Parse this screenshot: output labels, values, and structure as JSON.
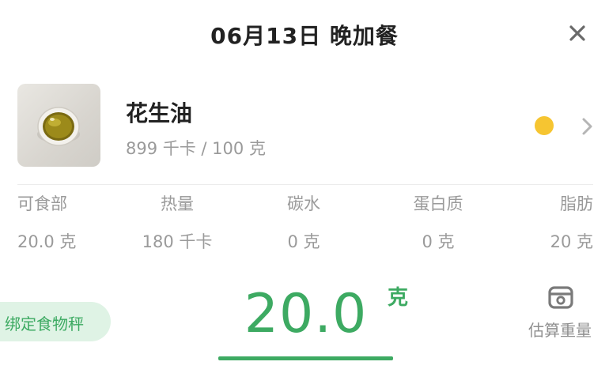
{
  "header": {
    "title": "06月13日 晚加餐",
    "close_icon": "close-icon"
  },
  "food": {
    "name": "花生油",
    "calories_text": "899 千卡 / 100 克",
    "thumbnail": "peanut-oil-dish-image",
    "status_color": "#f6c531",
    "chevron_icon": "chevron-right-icon"
  },
  "nutrition": [
    {
      "label": "可食部",
      "value": "20.0 克"
    },
    {
      "label": "热量",
      "value": "180 千卡"
    },
    {
      "label": "碳水",
      "value": "0 克"
    },
    {
      "label": "蛋白质",
      "value": "0 克"
    },
    {
      "label": "脂肪",
      "value": "20 克"
    }
  ],
  "weight": {
    "value": "20.0",
    "unit": "克"
  },
  "bind_scale": {
    "label": "绑定食物秤"
  },
  "estimate": {
    "label": "估算重量",
    "icon": "scale-icon"
  },
  "colors": {
    "accent": "#3daa62",
    "accent_light": "#dff3e5",
    "muted_text": "#9a9a9a"
  }
}
